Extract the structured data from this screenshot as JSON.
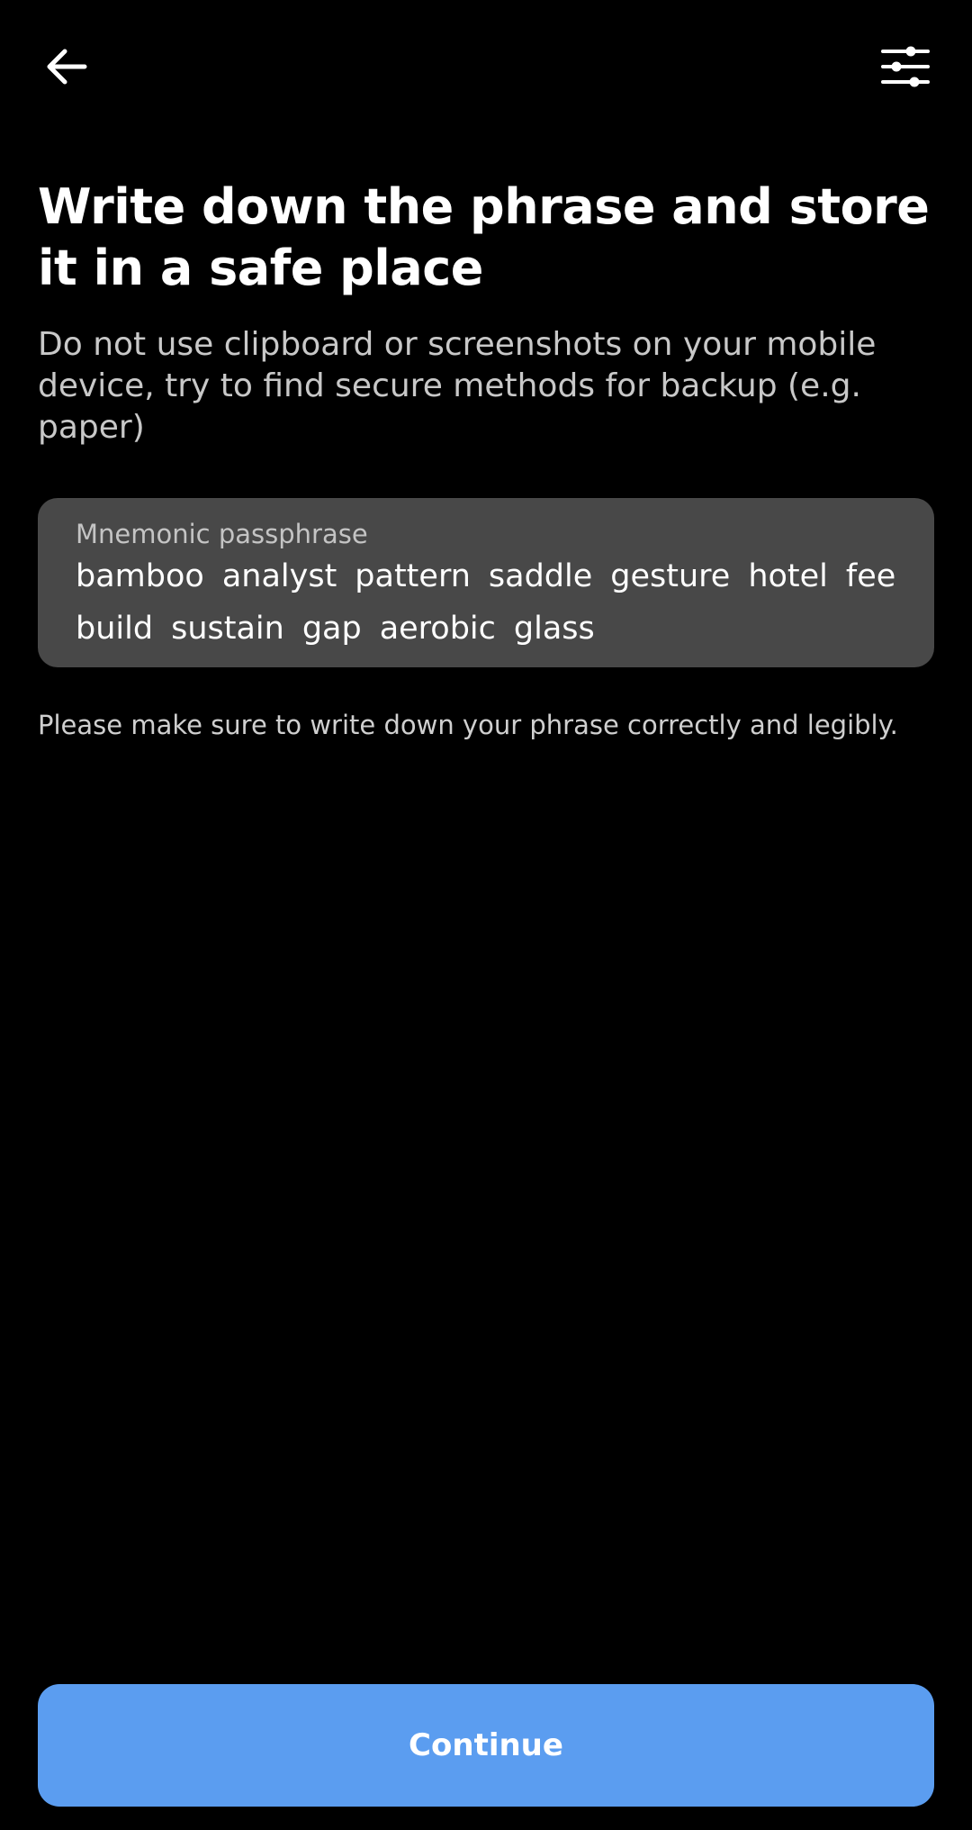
{
  "header": {
    "back_icon": "arrow-left-icon",
    "settings_icon": "sliders-icon"
  },
  "main": {
    "title": "Write down the phrase and store it in a safe place",
    "subtitle": "Do not use clipboard or screenshots on your mobile device, try to find secure methods for backup (e.g. paper)",
    "phrase_card": {
      "label": "Mnemonic passphrase",
      "words": [
        "bamboo",
        "analyst",
        "pattern",
        "saddle",
        "gesture",
        "hotel",
        "fee",
        "build",
        "sustain",
        "gap",
        "aerobic",
        "glass"
      ]
    },
    "note": "Please make sure to write down your phrase correctly and legibly."
  },
  "footer": {
    "continue_label": "Continue"
  },
  "colors": {
    "background": "#000000",
    "card": "#484848",
    "accent": "#5b9df0"
  }
}
